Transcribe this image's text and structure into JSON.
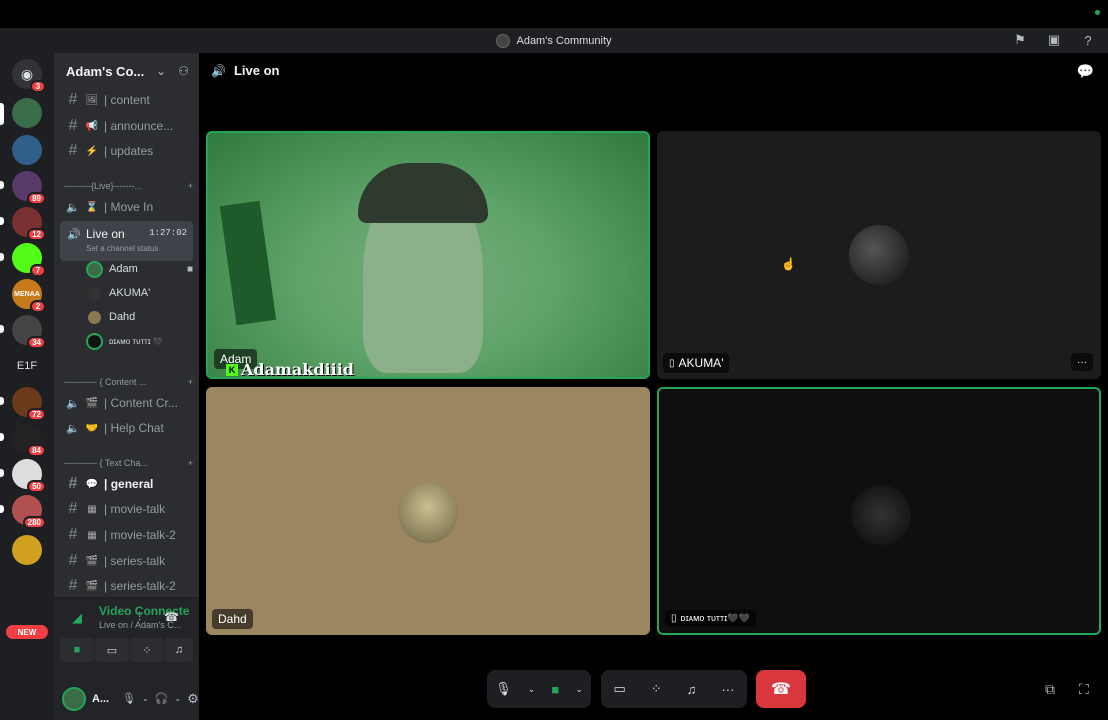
{
  "window": {
    "title": "Adam's Community",
    "icons": [
      "flag-icon",
      "inbox-icon",
      "help-icon"
    ]
  },
  "rail": {
    "badges": [
      "3",
      "89",
      "12",
      "7",
      "2",
      "34",
      "72",
      "84",
      "50",
      "280"
    ],
    "text_server": "E1F",
    "new_label": "NEW",
    "menaa_label": "MENAA"
  },
  "sidebar": {
    "server_name": "Adam's Co...",
    "channels_top": [
      {
        "emoji": "🖼",
        "label": "| content"
      },
      {
        "emoji": "📢",
        "label": "| announce..."
      },
      {
        "emoji": "⚡",
        "label": "| updates"
      }
    ],
    "cat_live": "---------{Live}-------...",
    "move_in": "| Move In",
    "live_channel": {
      "name": "Live on",
      "timer": "1:27:02",
      "status": "Set a channel status"
    },
    "voice_users": [
      {
        "name": "Adam",
        "color": "#3c6b48"
      },
      {
        "name": "AKUMA'",
        "color": "#333"
      },
      {
        "name": "Dahd",
        "color": "#8a7a52"
      },
      {
        "name": "ᴅɪᴀᴍᴏ ᴛᴜᴛᴛɪ 🖤",
        "color": "#111"
      }
    ],
    "cat_content": "----------- { Content ...",
    "content_channels": [
      "| Content Cr...",
      "| Help Chat"
    ],
    "cat_text": "----------- { Text Cha...",
    "text_channels": [
      "| general",
      "| movie-talk",
      "| movie-talk-2",
      "| series-talk",
      "| series-talk-2"
    ],
    "voice_panel": {
      "title": "Video Connecte",
      "sub": "Live on / Adam's C..."
    },
    "user_bar": {
      "name": "A..."
    }
  },
  "main": {
    "channel": "Live on",
    "tiles": [
      {
        "label": "Adam",
        "overlay": "Adamakdiiid"
      },
      {
        "label": "AKUMA'"
      },
      {
        "label": "Dahd"
      },
      {
        "label": "ᴅɪᴀᴍᴏ ᴛᴜᴛᴛɪ🖤🖤"
      }
    ],
    "more_label": "···"
  },
  "colors": {
    "accent_green": "#23a55a",
    "hangup_red": "#da373c",
    "dahd_tile": "#9b8660"
  }
}
